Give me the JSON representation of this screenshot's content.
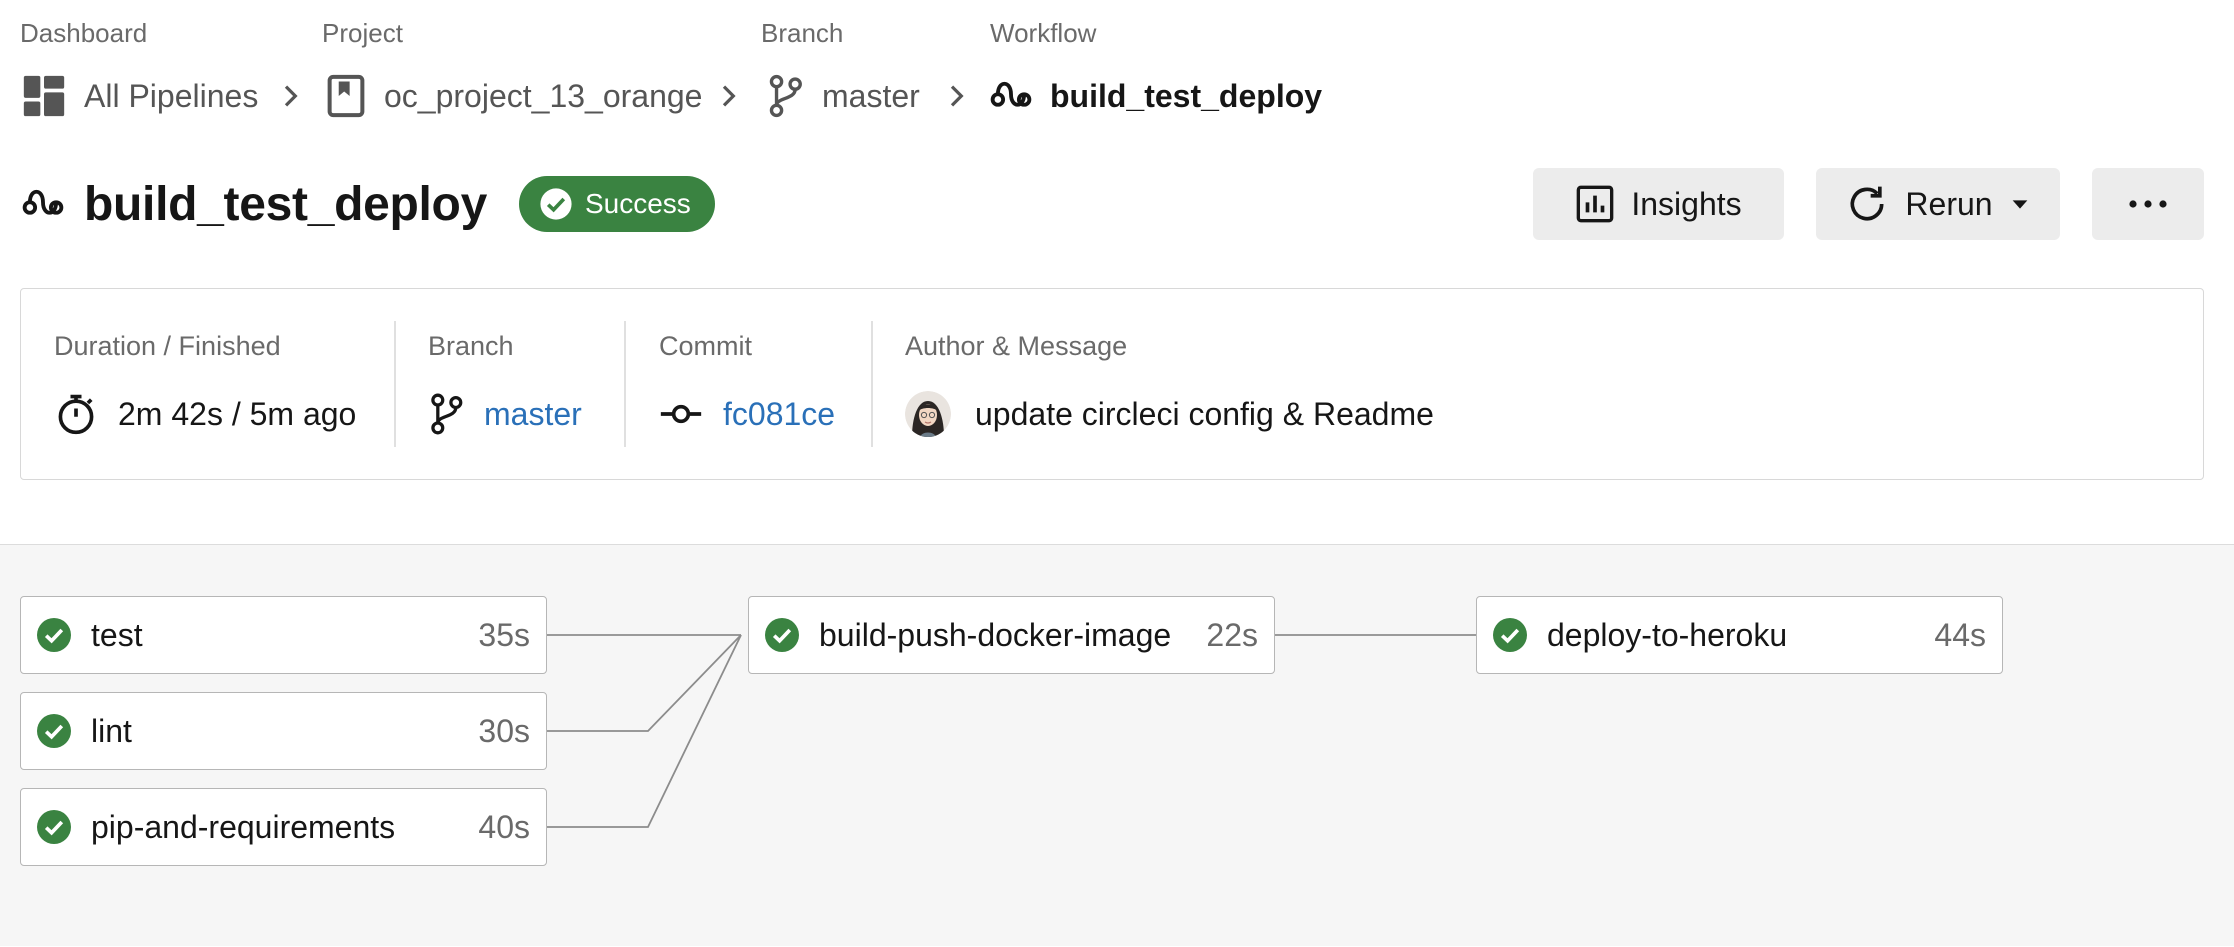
{
  "breadcrumb": {
    "labels": {
      "dashboard": "Dashboard",
      "project": "Project",
      "branch": "Branch",
      "workflow": "Workflow"
    },
    "items": [
      {
        "text": "All Pipelines",
        "icon": "dashboard-grid-icon"
      },
      {
        "text": "oc_project_13_orange",
        "icon": "project-bookmark-icon"
      },
      {
        "text": "master",
        "icon": "branch-icon"
      },
      {
        "text": "build_test_deploy",
        "icon": "workflow-icon"
      }
    ]
  },
  "header": {
    "title": "build_test_deploy",
    "status": "Success",
    "insights_label": "Insights",
    "rerun_label": "Rerun",
    "more_icon": "more-horizontal-icon"
  },
  "summary": {
    "duration_label": "Duration / Finished",
    "duration_value": "2m 42s / 5m ago",
    "branch_label": "Branch",
    "branch_value": "master",
    "commit_label": "Commit",
    "commit_value": "fc081ce",
    "author_label": "Author & Message",
    "message": "update circleci config & Readme"
  },
  "jobs": [
    {
      "name": "test",
      "duration": "35s",
      "status": "success"
    },
    {
      "name": "lint",
      "duration": "30s",
      "status": "success"
    },
    {
      "name": "pip-and-requirements",
      "duration": "40s",
      "status": "success"
    },
    {
      "name": "build-push-docker-image",
      "duration": "22s",
      "status": "success"
    },
    {
      "name": "deploy-to-heroku",
      "duration": "44s",
      "status": "success"
    }
  ],
  "colors": {
    "success": "#3a8341",
    "link": "#2a70b8",
    "button_bg": "#ececec",
    "graph_bg": "#f6f6f6"
  }
}
